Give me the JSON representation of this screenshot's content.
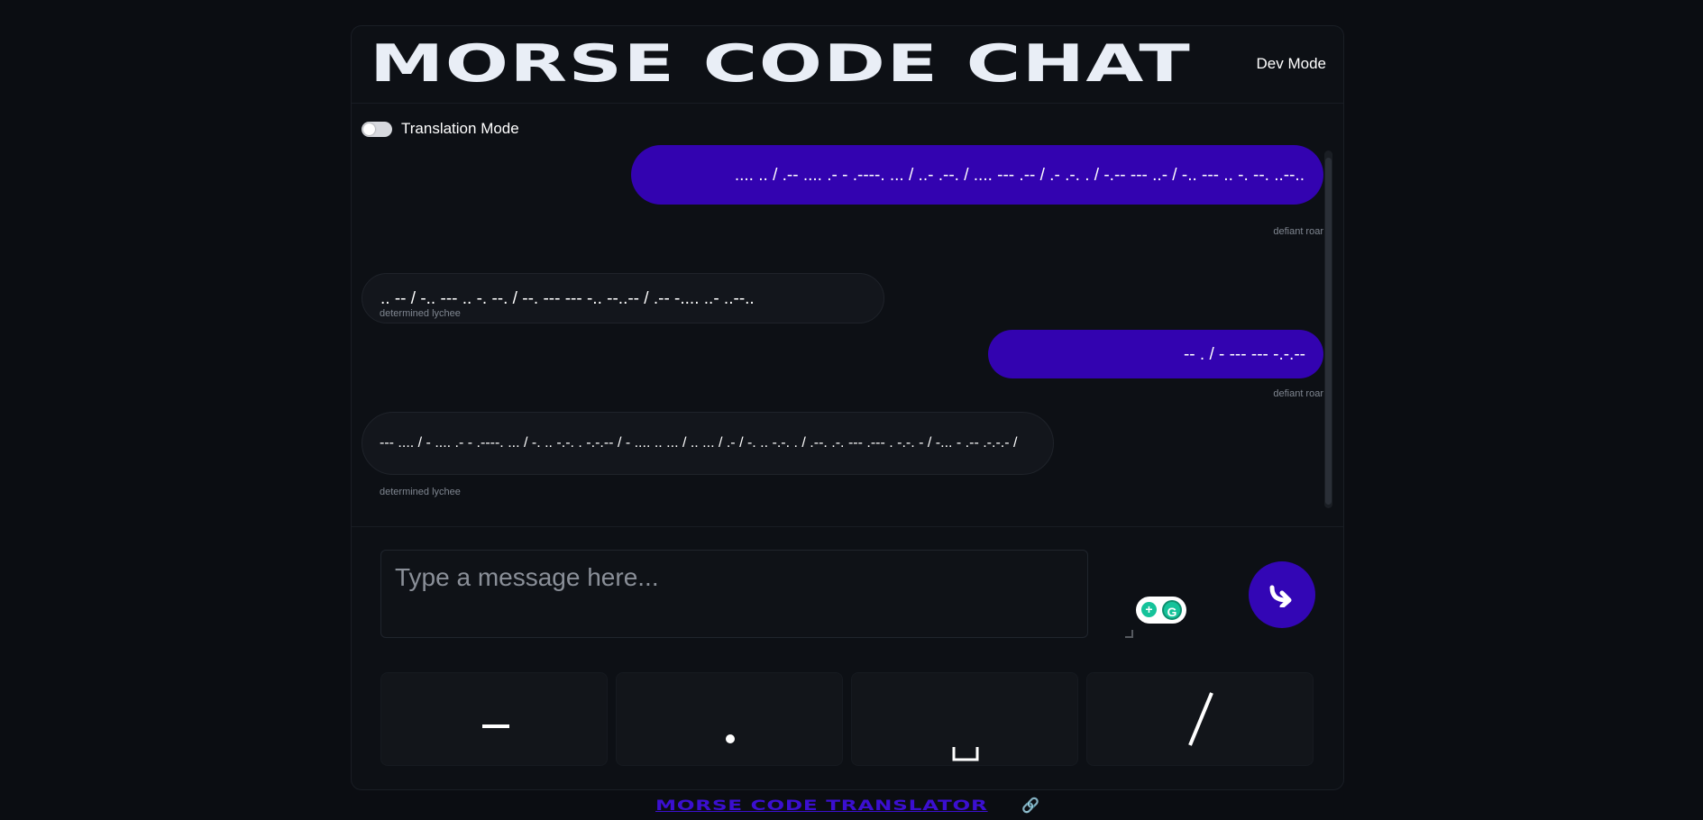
{
  "header": {
    "title": "MORSE CODE CHAT",
    "dev_mode_label": "Dev Mode"
  },
  "translation_mode": {
    "label": "Translation Mode",
    "enabled": false
  },
  "messages": [
    {
      "direction": "sent",
      "text": ".... .. / .-- .... .- - .----. ... / ..- .--. / .... --- .-- / .- .-. . / -.-- --- ..- / -.. --- .. -. --. ..--..",
      "sender": "defiant roar"
    },
    {
      "direction": "received",
      "text": ".. -- / -.. --- .. -. --. / --. --- --- -.. --..-- / .-- -.... ..- ..--..",
      "sender": "determined lychee"
    },
    {
      "direction": "sent",
      "text": "-- . / - --- --- -.-.--",
      "sender": "defiant roar"
    },
    {
      "direction": "received",
      "text": "--- .... / - .... .- - .----. ... / -. .. -.-. . -.-.-- / - .... .. ... / .. ... / .- / -. .. -.-. . / .--. .-. --- .--- . -.-. - / -... - .-- .-.-.- /",
      "sender": "determined lychee"
    }
  ],
  "composer": {
    "placeholder": "Type a message here...",
    "send_icon": "send-arrow-icon",
    "grammarly_icon": "grammarly-icon"
  },
  "keys": [
    {
      "label": "–",
      "name": "dash"
    },
    {
      "label": "•",
      "name": "dot"
    },
    {
      "label": "␣",
      "name": "space"
    },
    {
      "label": "/",
      "name": "slash"
    }
  ],
  "footer": {
    "link_text": "MORSE CODE TRANSLATOR",
    "link_icon": "🔗"
  },
  "colors": {
    "background": "#0b0d12",
    "panel": "#0d1015",
    "accent": "#3303b0",
    "link": "#3b0fd0"
  }
}
